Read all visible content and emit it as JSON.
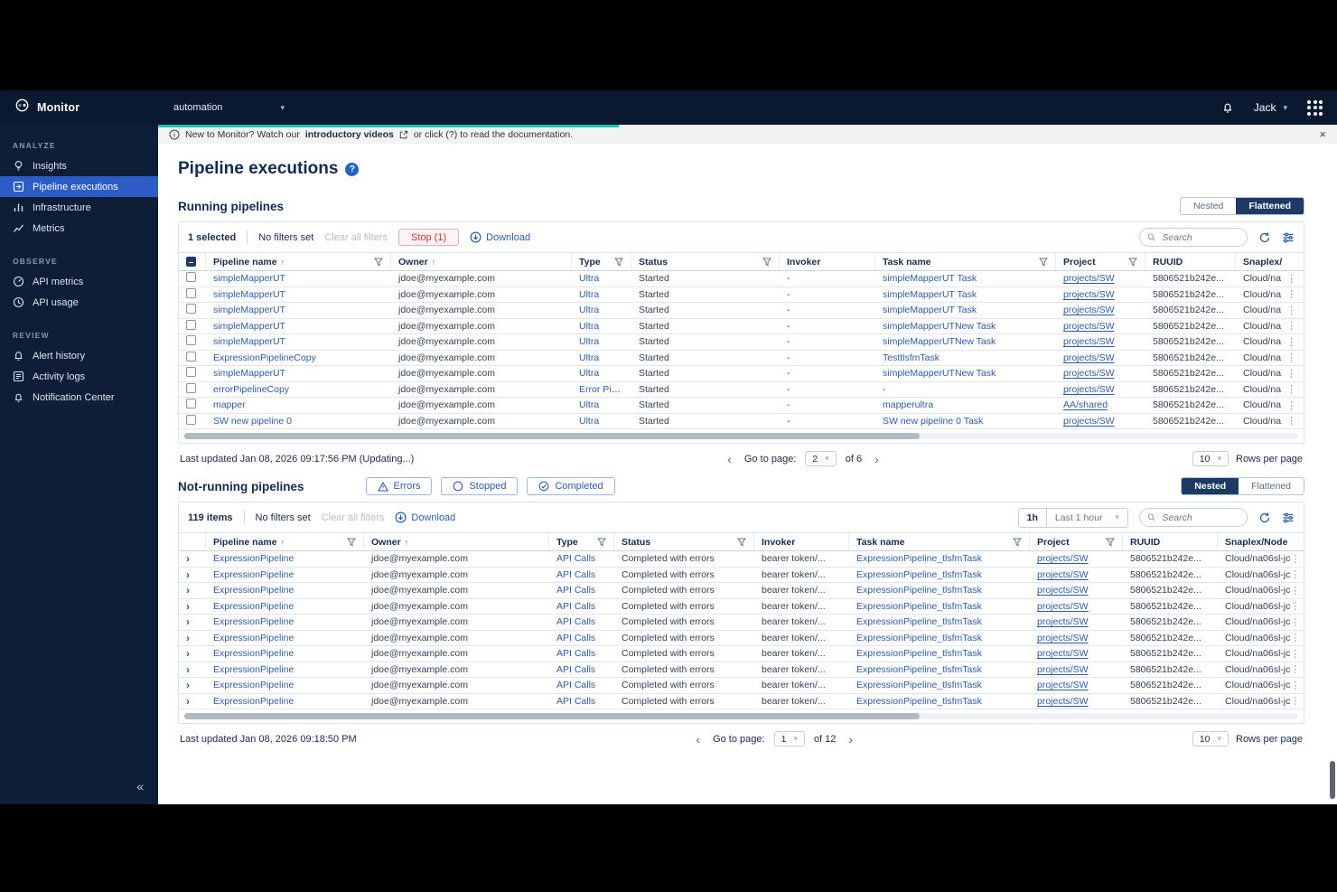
{
  "colors": {
    "accent_teal": "#12c9b6",
    "link_blue": "#2d5ba9",
    "active_blue": "#2c5cc5",
    "danger_red": "#c23b3b",
    "navy": "#0a1830"
  },
  "topbar": {
    "app_name": "Monitor",
    "org": "automation",
    "user": "Jack"
  },
  "banner": {
    "prefix": "New to Monitor? Watch our",
    "link": "introductory videos",
    "suffix": "or click (?) to read the documentation.",
    "close": "×"
  },
  "page_title": "Pipeline executions",
  "sidebar": {
    "collapse": "«",
    "sections": [
      {
        "label": "ANALYZE",
        "items": [
          {
            "label": "Insights"
          },
          {
            "label": "Pipeline executions"
          },
          {
            "label": "Infrastructure"
          },
          {
            "label": "Metrics"
          }
        ]
      },
      {
        "label": "OBSERVE",
        "items": [
          {
            "label": "API metrics"
          },
          {
            "label": "API usage"
          }
        ]
      },
      {
        "label": "REVIEW",
        "items": [
          {
            "label": "Alert history"
          },
          {
            "label": "Activity logs"
          },
          {
            "label": "Notification Center"
          }
        ]
      }
    ]
  },
  "running": {
    "heading": "Running pipelines",
    "view_toggle": {
      "nested": "Nested",
      "flattened": "Flattened",
      "selected": "Flattened"
    },
    "toolbar": {
      "selected_count": "1 selected",
      "no_filters": "No filters set",
      "clear_all": "Clear all filters",
      "stop_label": "Stop (1)",
      "download_label": "Download",
      "search_placeholder": "Search"
    },
    "columns": [
      "Pipeline name",
      "Owner",
      "Type",
      "Status",
      "Invoker",
      "Task name",
      "Project",
      "RUUID",
      "Snaplex/"
    ],
    "rows": [
      {
        "pipeline": "simpleMapperUT",
        "owner": "jdoe@myexample.com",
        "type": "Ultra",
        "status": "Started",
        "invoker": "-",
        "task": "simpleMapperUT Task",
        "project": "projects/SW",
        "ruuid": "5806521b242e...",
        "snaplex": "Cloud/na",
        "menu": "⋮"
      },
      {
        "pipeline": "simpleMapperUT",
        "owner": "jdoe@myexample.com",
        "type": "Ultra",
        "status": "Started",
        "invoker": "-",
        "task": "simpleMapperUT Task",
        "project": "projects/SW",
        "ruuid": "5806521b242e...",
        "snaplex": "Cloud/na",
        "menu": "⋮"
      },
      {
        "pipeline": "simpleMapperUT",
        "owner": "jdoe@myexample.com",
        "type": "Ultra",
        "status": "Started",
        "invoker": "-",
        "task": "simpleMapperUT Task",
        "project": "projects/SW",
        "ruuid": "5806521b242e...",
        "snaplex": "Cloud/na",
        "menu": "⋮"
      },
      {
        "pipeline": "simpleMapperUT",
        "owner": "jdoe@myexample.com",
        "type": "Ultra",
        "status": "Started",
        "invoker": "-",
        "task": "simpleMapperUTNew Task",
        "project": "projects/SW",
        "ruuid": "5806521b242e...",
        "snaplex": "Cloud/na",
        "menu": "⋮"
      },
      {
        "pipeline": "simpleMapperUT",
        "owner": "jdoe@myexample.com",
        "type": "Ultra",
        "status": "Started",
        "invoker": "-",
        "task": "simpleMapperUTNew Task",
        "project": "projects/SW",
        "ruuid": "5806521b242e...",
        "snaplex": "Cloud/na",
        "menu": "⋮"
      },
      {
        "pipeline": "ExpressionPipelineCopy",
        "owner": "jdoe@myexample.com",
        "type": "Ultra",
        "status": "Started",
        "invoker": "-",
        "task": "TesttlsfmTask",
        "project": "projects/SW",
        "ruuid": "5806521b242e...",
        "snaplex": "Cloud/na",
        "menu": "⋮"
      },
      {
        "pipeline": "simpleMapperUT",
        "owner": "jdoe@myexample.com",
        "type": "Ultra",
        "status": "Started",
        "invoker": "-",
        "task": "simpleMapperUTNew Task",
        "project": "projects/SW",
        "ruuid": "5806521b242e...",
        "snaplex": "Cloud/na",
        "menu": "⋮"
      },
      {
        "pipeline": "errorPipelineCopy",
        "owner": "jdoe@myexample.com",
        "type": "Error Pipe...",
        "status": "Started",
        "invoker": "-",
        "task": "-",
        "project": "projects/SW",
        "ruuid": "5806521b242e...",
        "snaplex": "Cloud/na",
        "menu": "⋮"
      },
      {
        "pipeline": "mapper",
        "owner": "jdoe@myexample.com",
        "type": "Ultra",
        "status": "Started",
        "invoker": "-",
        "task": "mapperultra",
        "project": "AA/shared",
        "ruuid": "5806521b242e...",
        "snaplex": "Cloud/na",
        "menu": "⋮"
      },
      {
        "pipeline": "SW new pipeline 0",
        "owner": "jdoe@myexample.com",
        "type": "Ultra",
        "status": "Started",
        "invoker": "-",
        "task": "SW new pipeline 0 Task",
        "project": "projects/SW",
        "ruuid": "5806521b242e...",
        "snaplex": "Cloud/na",
        "menu": "⋮"
      }
    ],
    "footer": {
      "last_updated": "Last updated Jan 08, 2026 09:17:56 PM (Updating...)",
      "prev": "‹",
      "next": "›",
      "go_to_page_label": "Go to page:",
      "current_page": "2",
      "total_pages": "of 6",
      "rows_per_page_value": "10",
      "rows_per_page_label": "Rows per page"
    }
  },
  "not_running": {
    "heading": "Not-running pipelines",
    "chips": [
      {
        "label": "Errors"
      },
      {
        "label": "Stopped"
      },
      {
        "label": "Completed"
      }
    ],
    "view_toggle": {
      "nested": "Nested",
      "flattened": "Flattened",
      "selected": "Nested"
    },
    "toolbar": {
      "items_count": "119 items",
      "no_filters": "No filters set",
      "clear_all": "Clear all filters",
      "download_label": "Download",
      "time_short": "1h",
      "time_range": "Last 1 hour",
      "search_placeholder": "Search"
    },
    "columns": [
      "Pipeline name",
      "Owner",
      "Type",
      "Status",
      "Invoker",
      "Task name",
      "Project",
      "RUUID",
      "Snaplex/Node"
    ],
    "rows": [
      {
        "expand": "›",
        "pipeline": "ExpressionPipeline",
        "owner": "jdoe@myexample.com",
        "type": "API Calls",
        "status": "Completed with errors",
        "invoker": "bearer token/...",
        "task": "ExpressionPipeline_tlsfmTask",
        "project": "projects/SW",
        "ruuid": "5806521b242e...",
        "snaplex": "Cloud/na06sl-jc",
        "menu": "⋮"
      },
      {
        "expand": "›",
        "pipeline": "ExpressionPipeline",
        "owner": "jdoe@myexample.com",
        "type": "API Calls",
        "status": "Completed with errors",
        "invoker": "bearer token/...",
        "task": "ExpressionPipeline_tlsfmTask",
        "project": "projects/SW",
        "ruuid": "5806521b242e...",
        "snaplex": "Cloud/na06sl-jc",
        "menu": "⋮"
      },
      {
        "expand": "›",
        "pipeline": "ExpressionPipeline",
        "owner": "jdoe@myexample.com",
        "type": "API Calls",
        "status": "Completed with errors",
        "invoker": "bearer token/...",
        "task": "ExpressionPipeline_tlsfmTask",
        "project": "projects/SW",
        "ruuid": "5806521b242e...",
        "snaplex": "Cloud/na06sl-jc",
        "menu": "⋮"
      },
      {
        "expand": "›",
        "pipeline": "ExpressionPipeline",
        "owner": "jdoe@myexample.com",
        "type": "API Calls",
        "status": "Completed with errors",
        "invoker": "bearer token/...",
        "task": "ExpressionPipeline_tlsfmTask",
        "project": "projects/SW",
        "ruuid": "5806521b242e...",
        "snaplex": "Cloud/na06sl-jc",
        "menu": "⋮"
      },
      {
        "expand": "›",
        "pipeline": "ExpressionPipeline",
        "owner": "jdoe@myexample.com",
        "type": "API Calls",
        "status": "Completed with errors",
        "invoker": "bearer token/...",
        "task": "ExpressionPipeline_tlsfmTask",
        "project": "projects/SW",
        "ruuid": "5806521b242e...",
        "snaplex": "Cloud/na06sl-jc",
        "menu": "⋮"
      },
      {
        "expand": "›",
        "pipeline": "ExpressionPipeline",
        "owner": "jdoe@myexample.com",
        "type": "API Calls",
        "status": "Completed with errors",
        "invoker": "bearer token/...",
        "task": "ExpressionPipeline_tlsfmTask",
        "project": "projects/SW",
        "ruuid": "5806521b242e...",
        "snaplex": "Cloud/na06sl-jc",
        "menu": "⋮"
      },
      {
        "expand": "›",
        "pipeline": "ExpressionPipeline",
        "owner": "jdoe@myexample.com",
        "type": "API Calls",
        "status": "Completed with errors",
        "invoker": "bearer token/...",
        "task": "ExpressionPipeline_tlsfmTask",
        "project": "projects/SW",
        "ruuid": "5806521b242e...",
        "snaplex": "Cloud/na06sl-jc",
        "menu": "⋮"
      },
      {
        "expand": "›",
        "pipeline": "ExpressionPipeline",
        "owner": "jdoe@myexample.com",
        "type": "API Calls",
        "status": "Completed with errors",
        "invoker": "bearer token/...",
        "task": "ExpressionPipeline_tlsfmTask",
        "project": "projects/SW",
        "ruuid": "5806521b242e...",
        "snaplex": "Cloud/na06sl-jc",
        "menu": "⋮"
      },
      {
        "expand": "›",
        "pipeline": "ExpressionPipeline",
        "owner": "jdoe@myexample.com",
        "type": "API Calls",
        "status": "Completed with errors",
        "invoker": "bearer token/...",
        "task": "ExpressionPipeline_tlsfmTask",
        "project": "projects/SW",
        "ruuid": "5806521b242e...",
        "snaplex": "Cloud/na06sl-jc",
        "menu": "⋮"
      },
      {
        "expand": "›",
        "pipeline": "ExpressionPipeline",
        "owner": "jdoe@myexample.com",
        "type": "API Calls",
        "status": "Completed with errors",
        "invoker": "bearer token/...",
        "task": "ExpressionPipeline_tlsfmTask",
        "project": "projects/SW",
        "ruuid": "5806521b242e...",
        "snaplex": "Cloud/na06sl-jc",
        "menu": "⋮"
      }
    ],
    "footer": {
      "last_updated": "Last updated Jan 08, 2026 09:18:50 PM",
      "prev": "‹",
      "next": "›",
      "go_to_page_label": "Go to page:",
      "current_page": "1",
      "total_pages": "of 12",
      "rows_per_page_value": "10",
      "rows_per_page_label": "Rows per page"
    }
  }
}
